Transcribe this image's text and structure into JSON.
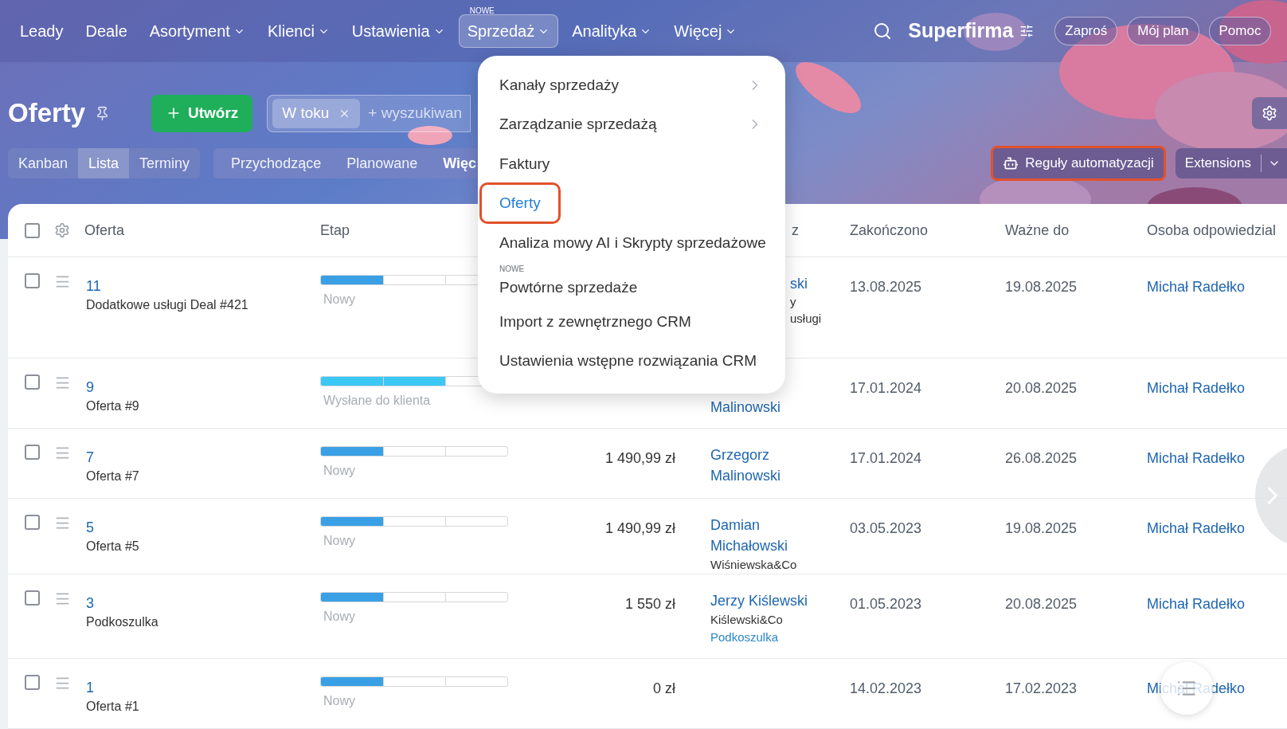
{
  "nav": {
    "items": [
      {
        "label": "Leady",
        "dropdown": false,
        "selected": false
      },
      {
        "label": "Deale",
        "dropdown": false,
        "selected": false
      },
      {
        "label": "Asortyment",
        "dropdown": true,
        "selected": false
      },
      {
        "label": "Klienci",
        "dropdown": true,
        "selected": false
      },
      {
        "label": "Ustawienia",
        "dropdown": true,
        "selected": false
      },
      {
        "label": "Sprzedaż",
        "dropdown": true,
        "selected": true,
        "badge": "NOWE"
      },
      {
        "label": "Analityka",
        "dropdown": true,
        "selected": false
      },
      {
        "label": "Więcej",
        "dropdown": true,
        "selected": false
      }
    ],
    "brand": "Superfirma",
    "buttons": [
      "Zaproś",
      "Mój plan",
      "Pomoc"
    ]
  },
  "toolbar": {
    "title": "Oferty",
    "create": "Utwórz",
    "filter_chip": "W toku",
    "search_placeholder": "+ wyszukiwan",
    "view_tabs": [
      {
        "label": "Kanban",
        "selected": false
      },
      {
        "label": "Lista",
        "selected": true
      },
      {
        "label": "Terminy",
        "selected": false
      }
    ],
    "filter_tabs": [
      "Przychodzące",
      "Planowane",
      "Więc"
    ],
    "automation": {
      "label": "Reguły automatyzacji",
      "highlighted": true
    },
    "extensions": "Extensions"
  },
  "menu": {
    "items": [
      {
        "label": "Kanały sprzedaży",
        "submenu": true,
        "selected": false,
        "highlighted": false
      },
      {
        "label": "Zarządzanie sprzedażą",
        "submenu": true,
        "selected": false,
        "highlighted": false
      },
      {
        "label": "Faktury",
        "selected": false,
        "highlighted": false
      },
      {
        "label": "Oferty",
        "selected": true,
        "highlighted": true
      },
      {
        "label": "Analiza mowy AI i Skrypty sprzedażowe",
        "selected": false,
        "highlighted": false
      },
      {
        "label": "Powtórne sprzedaże",
        "selected": false,
        "highlighted": false,
        "badge": "NOWE"
      },
      {
        "label": "Import z zewnętrznego CRM",
        "selected": false,
        "highlighted": false
      },
      {
        "label": "Ustawienia wstępne rozwiązania CRM",
        "selected": false,
        "highlighted": false
      }
    ]
  },
  "table": {
    "select_all_checked": false,
    "columns": [
      "Oferta",
      "Etap",
      "z",
      "Zakończono",
      "Ważne do",
      "Osoba odpowiedzial"
    ],
    "rows": [
      {
        "checked": false,
        "id": "11",
        "name": "Dodatkowe usługi Deal #421",
        "stage": {
          "label": "Nowy",
          "level": 0.333,
          "color": "#3aa0e5"
        },
        "contact": {
          "covered_left": true,
          "lines": [
            {
              "kind": "link",
              "text": "ski"
            },
            {
              "kind": "text",
              "text": "y"
            },
            {
              "kind": "company",
              "text": "usługi"
            }
          ]
        },
        "closed": "13.08.2025",
        "valid": "19.08.2025",
        "owner": "Michał Radełko"
      },
      {
        "checked": false,
        "id": "9",
        "name": "Oferta #9",
        "stage": {
          "label": "Wysłane do klienta",
          "level": 0.667,
          "color": "#3bc8f5"
        },
        "contact": {
          "covered_top": true,
          "lines": [
            {
              "kind": "link",
              "text": "Malinowski"
            }
          ]
        },
        "closed": "17.01.2024",
        "valid": "20.08.2025",
        "owner": "Michał Radełko"
      },
      {
        "checked": false,
        "id": "7",
        "name": "Oferta #7",
        "stage": {
          "label": "Nowy",
          "level": 0.333,
          "color": "#3aa0e5"
        },
        "amount": "1 490,99 zł",
        "contact": {
          "lines": [
            {
              "kind": "link",
              "text": "Grzegorz Malinowski"
            }
          ]
        },
        "closed": "17.01.2024",
        "valid": "26.08.2025",
        "owner": "Michał Radełko"
      },
      {
        "checked": false,
        "id": "5",
        "name": "Oferta #5",
        "stage": {
          "label": "Nowy",
          "level": 0.333,
          "color": "#3aa0e5"
        },
        "amount": "1 490,99 zł",
        "contact": {
          "lines": [
            {
              "kind": "link",
              "text": "Damian Michałowski"
            },
            {
              "kind": "company",
              "text": "Wiśniewska&Co"
            }
          ]
        },
        "closed": "03.05.2023",
        "valid": "19.08.2025",
        "owner": "Michał Radełko"
      },
      {
        "checked": false,
        "id": "3",
        "name": "Podkoszulka",
        "stage": {
          "label": "Nowy",
          "level": 0.333,
          "color": "#3aa0e5"
        },
        "amount": "1 550 zł",
        "contact": {
          "lines": [
            {
              "kind": "link",
              "text": "Jerzy Kiślewski"
            },
            {
              "kind": "company",
              "text": "Kiślewski&Co"
            },
            {
              "kind": "deal",
              "text": "Podkoszulka"
            }
          ]
        },
        "closed": "01.05.2023",
        "valid": "20.08.2025",
        "owner": "Michał Radełko"
      },
      {
        "checked": false,
        "id": "1",
        "name": "Oferta #1",
        "stage": {
          "label": "Nowy",
          "level": 0.333,
          "color": "#3aa0e5"
        },
        "amount": "0 zł",
        "closed": "14.02.2023",
        "valid": "17.02.2023",
        "owner": "Michał Radełko"
      }
    ]
  }
}
